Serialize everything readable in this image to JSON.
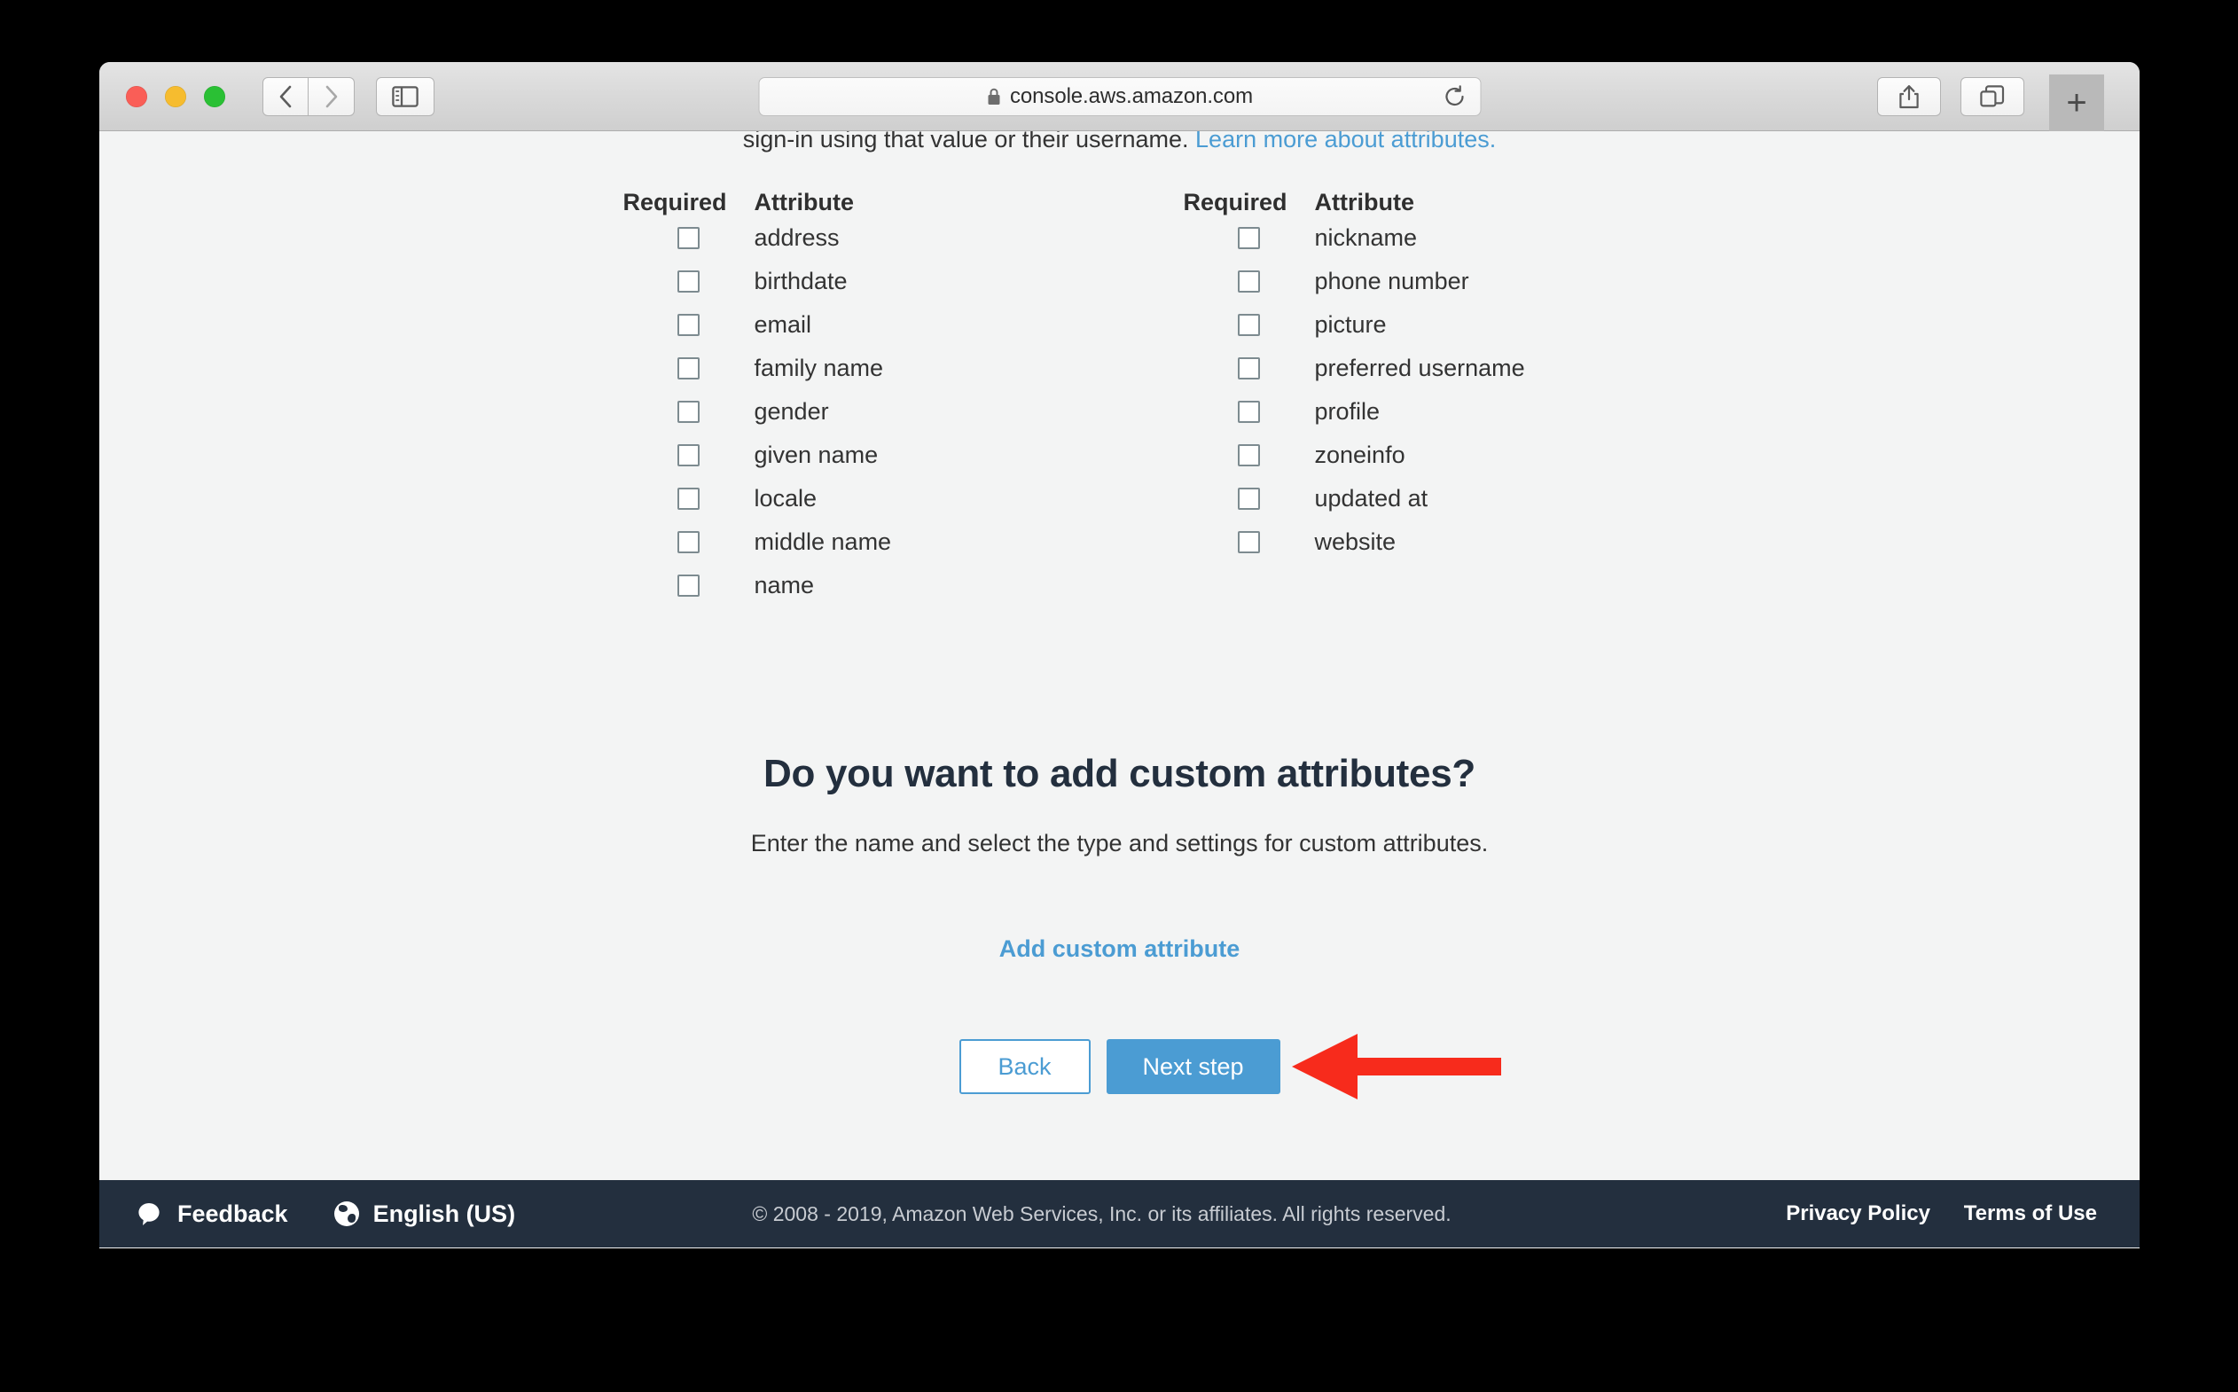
{
  "browser": {
    "url": "console.aws.amazon.com",
    "lock_icon": "lock-icon",
    "reload_icon": "reload-icon",
    "back_icon": "chevron-left-icon",
    "forward_icon": "chevron-right-icon",
    "sidebar_icon": "sidebar-toggle-icon",
    "share_icon": "share-icon",
    "tabs_icon": "tab-overview-icon",
    "new_tab_label": "+"
  },
  "page": {
    "intro_text": "sign-in using that value or their username. ",
    "intro_link": "Learn more about attributes.",
    "columns": [
      {
        "header_required": "Required",
        "header_attribute": "Attribute",
        "rows": [
          {
            "label": "address",
            "checked": false
          },
          {
            "label": "birthdate",
            "checked": false
          },
          {
            "label": "email",
            "checked": false
          },
          {
            "label": "family name",
            "checked": false
          },
          {
            "label": "gender",
            "checked": false
          },
          {
            "label": "given name",
            "checked": false
          },
          {
            "label": "locale",
            "checked": false
          },
          {
            "label": "middle name",
            "checked": false
          },
          {
            "label": "name",
            "checked": false
          }
        ]
      },
      {
        "header_required": "Required",
        "header_attribute": "Attribute",
        "rows": [
          {
            "label": "nickname",
            "checked": false
          },
          {
            "label": "phone number",
            "checked": false
          },
          {
            "label": "picture",
            "checked": false
          },
          {
            "label": "preferred username",
            "checked": false
          },
          {
            "label": "profile",
            "checked": false
          },
          {
            "label": "zoneinfo",
            "checked": false
          },
          {
            "label": "updated at",
            "checked": false
          },
          {
            "label": "website",
            "checked": false
          }
        ]
      }
    ],
    "custom": {
      "heading": "Do you want to add custom attributes?",
      "subtitle": "Enter the name and select the type and settings for custom attributes.",
      "add_link": "Add custom attribute"
    },
    "actions": {
      "back_label": "Back",
      "next_label": "Next step",
      "annotation_icon": "red-arrow-left-icon"
    }
  },
  "footer": {
    "feedback_label": "Feedback",
    "feedback_icon": "speech-bubble-icon",
    "language_label": "English (US)",
    "language_icon": "globe-icon",
    "copyright": "© 2008 - 2019, Amazon Web Services, Inc. or its affiliates. All rights reserved.",
    "privacy_policy": "Privacy Policy",
    "terms_of_use": "Terms of Use"
  },
  "colors": {
    "accent_blue": "#4b9cd3",
    "footer_navy": "#232f3e",
    "page_bg": "#f3f4f4",
    "annotation_red": "#f72b1c",
    "checkbox_border": "#7d8b90"
  }
}
